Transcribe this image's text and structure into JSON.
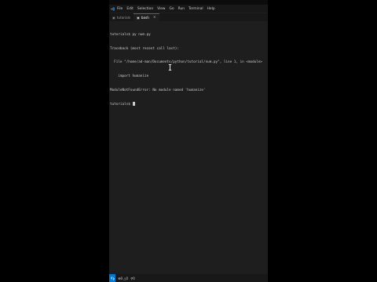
{
  "menubar": {
    "items": [
      "File",
      "Edit",
      "Selection",
      "View",
      "Go",
      "Run",
      "Terminal",
      "Help"
    ]
  },
  "tabs": [
    {
      "label": "tutorials",
      "icon": "terminal-icon",
      "active": false
    },
    {
      "label": "bash",
      "icon": "terminal-icon",
      "active": true,
      "close": "×"
    }
  ],
  "terminal": {
    "lines": [
      "tutorials$ py num.py",
      "Traceback (most recent call last):",
      "  File \"/home/ad-man/Documents/python/tutorial/num.py\", line 1, in <module>",
      "    import humanize",
      "ModuleNotFoundError: No module named 'humanize'",
      "tutorials$ "
    ]
  },
  "statusbar": {
    "errors": "0",
    "warnings": "0",
    "ports": "0"
  },
  "colors": {
    "accent": "#0078d4",
    "editor_bg": "#1e1e1e",
    "chrome_bg": "#181818",
    "text": "#cccccc"
  }
}
